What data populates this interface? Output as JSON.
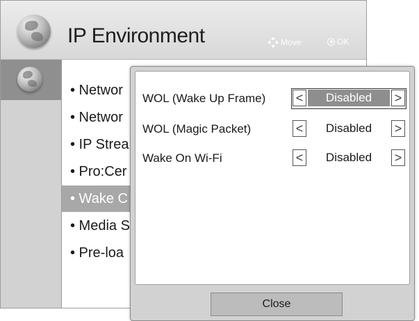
{
  "header": {
    "title": "IP Environment",
    "hints": {
      "move": "Move",
      "ok": "OK"
    }
  },
  "menu": {
    "items": [
      {
        "label": "• Networ",
        "selected": false
      },
      {
        "label": "• Networ",
        "selected": false
      },
      {
        "label": "• IP Strea",
        "selected": false
      },
      {
        "label": "• Pro:Cer",
        "selected": false
      },
      {
        "label": "• Wake C",
        "selected": true
      },
      {
        "label": "• Media S",
        "selected": false
      },
      {
        "label": "• Pre-loa",
        "selected": false
      }
    ]
  },
  "popup": {
    "options": [
      {
        "label": "WOL (Wake Up Frame)",
        "value": "Disabled",
        "focused": true
      },
      {
        "label": "WOL (Magic Packet)",
        "value": "Disabled",
        "focused": false
      },
      {
        "label": "Wake On Wi-Fi",
        "value": "Disabled",
        "focused": false
      }
    ],
    "arrow_left": "<",
    "arrow_right": ">",
    "close_label": "Close"
  },
  "colors": {
    "selected_bg": "#a8a8a8",
    "focus_value_bg": "#8e8e8e",
    "panel_bg": "#d2d2d2"
  }
}
